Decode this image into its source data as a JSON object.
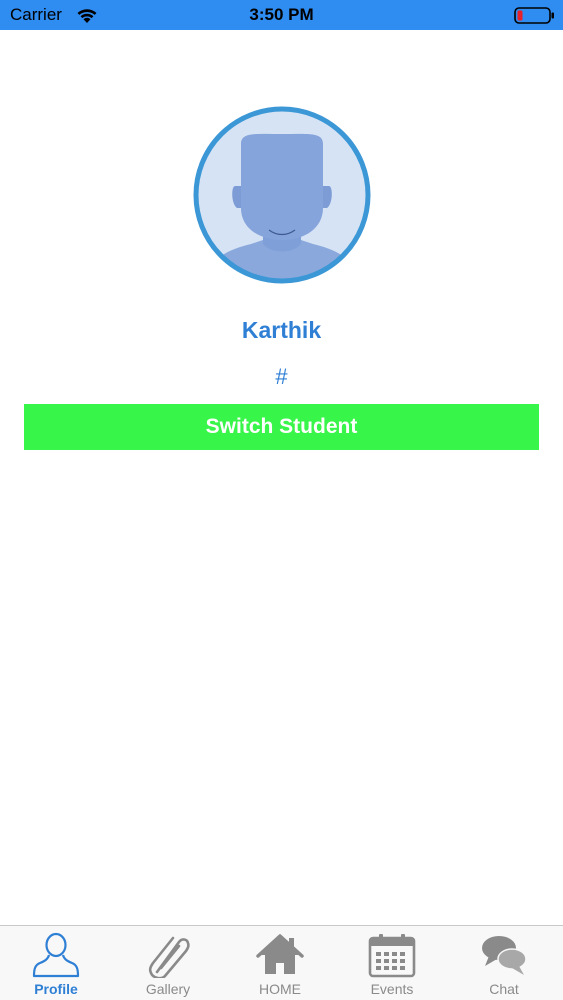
{
  "status_bar": {
    "carrier": "Carrier",
    "time": "3:50 PM",
    "background_color": "#2f8cf0"
  },
  "profile": {
    "avatar_icon": "person-placeholder-icon",
    "name": "Karthik",
    "id": "#",
    "accent_color": "#2f80d5"
  },
  "switch_button": {
    "label": "Switch Student",
    "color": "#38f549"
  },
  "tab_bar": {
    "active_color": "#2f80d5",
    "inactive_color": "#8a8a8a",
    "tabs": [
      {
        "label": "Profile",
        "icon": "person-icon",
        "active": true
      },
      {
        "label": "Gallery",
        "icon": "paperclip-icon",
        "active": false
      },
      {
        "label": "HOME",
        "icon": "home-icon",
        "active": false
      },
      {
        "label": "Events",
        "icon": "calendar-icon",
        "active": false
      },
      {
        "label": "Chat",
        "icon": "chat-bubbles-icon",
        "active": false
      }
    ]
  }
}
